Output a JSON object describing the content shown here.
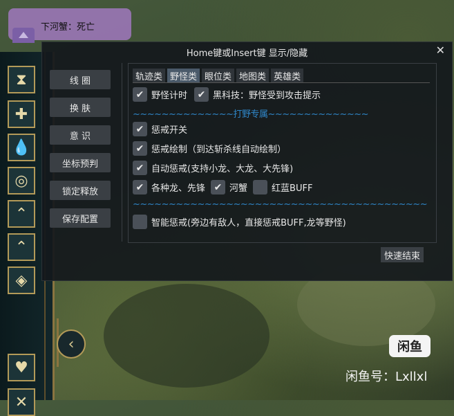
{
  "notification": {
    "text": "下河蟹：死亡"
  },
  "window": {
    "title": "Home键或Insert键  显示/隐藏",
    "close_glyph": "✕"
  },
  "menu": [
    "线 圈",
    "换 肤",
    "意 识",
    "坐标预判",
    "锁定释放",
    "保存配置"
  ],
  "tabs": [
    {
      "label": "轨迹类",
      "active": false
    },
    {
      "label": "野怪类",
      "active": true
    },
    {
      "label": "眼位类",
      "active": false
    },
    {
      "label": "地图类",
      "active": false
    },
    {
      "label": "英雄类",
      "active": false
    }
  ],
  "options": {
    "row1": [
      {
        "label": "野怪计时",
        "checked": true
      },
      {
        "label": "黑科技：野怪受到攻击提示",
        "checked": true
      }
    ],
    "divider1": "~~~~~~~~~~~~~~打野专属~~~~~~~~~~~~~~",
    "smite_toggle": {
      "label": "惩戒开关",
      "checked": true
    },
    "smite_draw": {
      "label": "惩戒绘制（到达斩杀线自动绘制）",
      "checked": true
    },
    "auto_smite": {
      "label": "自动惩戒(支持小龙、大龙、大先锋)",
      "checked": true
    },
    "row_targets": [
      {
        "label": "各种龙、先锋",
        "checked": true
      },
      {
        "label": "河蟹",
        "checked": true
      },
      {
        "label": "红蓝BUFF",
        "checked": false
      }
    ],
    "divider2": "~~~~~~~~~~~~~~~~~~~~~~~~~~~~~~~~~~~~~~~~~",
    "smart_smite": {
      "label": "智能惩戒(旁边有敌人，直接惩戒BUFF,龙等野怪)",
      "checked": false
    }
  },
  "finish_button": "快速结束",
  "check_glyph": "✔",
  "watermark": {
    "logo": "闲鱼",
    "text": "闲鱼号：Lxllxl"
  },
  "sidebar_icons": [
    "hourglass-icon",
    "plus-icon",
    "drop-icon",
    "coins-icon",
    "chevron-up-icon",
    "lock-chevron-icon",
    "diamond-icon",
    "heart-icon",
    "close-icon"
  ],
  "colors": {
    "accent_blue": "#2f86c8",
    "frame_gold": "#b39a58",
    "panel_bg": "#14181c"
  }
}
